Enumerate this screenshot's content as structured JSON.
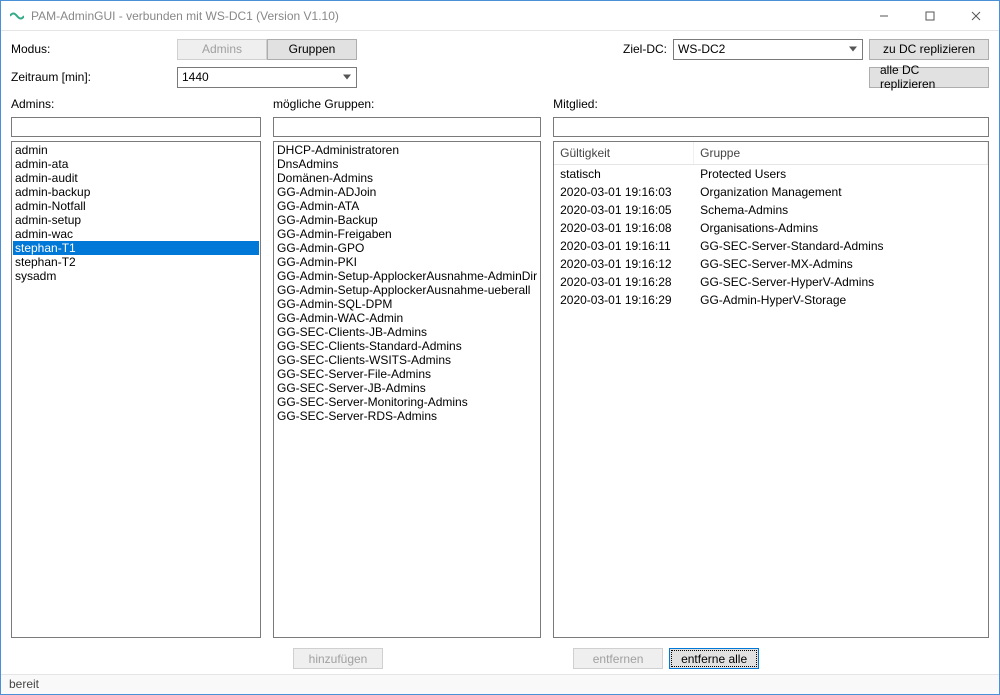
{
  "window": {
    "title": "PAM-AdminGUI - verbunden mit WS-DC1 (Version V1.10)"
  },
  "labels": {
    "modus": "Modus:",
    "zeitraum": "Zeitraum [min]:",
    "ziel_dc": "Ziel-DC:",
    "admins": "Admins:",
    "moegliche_gruppen": "mögliche Gruppen:",
    "mitglied": "Mitglied:"
  },
  "buttons": {
    "modus_admins": "Admins",
    "modus_gruppen": "Gruppen",
    "zu_dc": "zu DC replizieren",
    "alle_dc": "alle DC replizieren",
    "hinzufuegen": "hinzufügen",
    "entfernen": "entfernen",
    "entferne_alle": "entferne alle"
  },
  "values": {
    "zeitraum": "1440",
    "ziel_dc": "WS-DC2"
  },
  "admins_list": [
    "admin",
    "admin-ata",
    "admin-audit",
    "admin-backup",
    "admin-Notfall",
    "admin-setup",
    "admin-wac",
    "stephan-T1",
    "stephan-T2",
    "sysadm"
  ],
  "admins_selected": "stephan-T1",
  "groups_list": [
    "DHCP-Administratoren",
    "DnsAdmins",
    "Domänen-Admins",
    "GG-Admin-ADJoin",
    "GG-Admin-ATA",
    "GG-Admin-Backup",
    "GG-Admin-Freigaben",
    "GG-Admin-GPO",
    "GG-Admin-PKI",
    "GG-Admin-Setup-ApplockerAusnahme-AdminDir",
    "GG-Admin-Setup-ApplockerAusnahme-ueberall",
    "GG-Admin-SQL-DPM",
    "GG-Admin-WAC-Admin",
    "GG-SEC-Clients-JB-Admins",
    "GG-SEC-Clients-Standard-Admins",
    "GG-SEC-Clients-WSITS-Admins",
    "GG-SEC-Server-File-Admins",
    "GG-SEC-Server-JB-Admins",
    "GG-SEC-Server-Monitoring-Admins",
    "GG-SEC-Server-RDS-Admins"
  ],
  "member_columns": {
    "gueltigkeit": "Gültigkeit",
    "gruppe": "Gruppe"
  },
  "member_rows": [
    {
      "gueltigkeit": "statisch",
      "gruppe": "Protected Users"
    },
    {
      "gueltigkeit": "2020-03-01 19:16:03",
      "gruppe": "Organization Management"
    },
    {
      "gueltigkeit": "2020-03-01 19:16:05",
      "gruppe": "Schema-Admins"
    },
    {
      "gueltigkeit": "2020-03-01 19:16:08",
      "gruppe": "Organisations-Admins"
    },
    {
      "gueltigkeit": "2020-03-01 19:16:11",
      "gruppe": "GG-SEC-Server-Standard-Admins"
    },
    {
      "gueltigkeit": "2020-03-01 19:16:12",
      "gruppe": "GG-SEC-Server-MX-Admins"
    },
    {
      "gueltigkeit": "2020-03-01 19:16:28",
      "gruppe": "GG-SEC-Server-HyperV-Admins"
    },
    {
      "gueltigkeit": "2020-03-01 19:16:29",
      "gruppe": "GG-Admin-HyperV-Storage"
    }
  ],
  "status": "bereit"
}
